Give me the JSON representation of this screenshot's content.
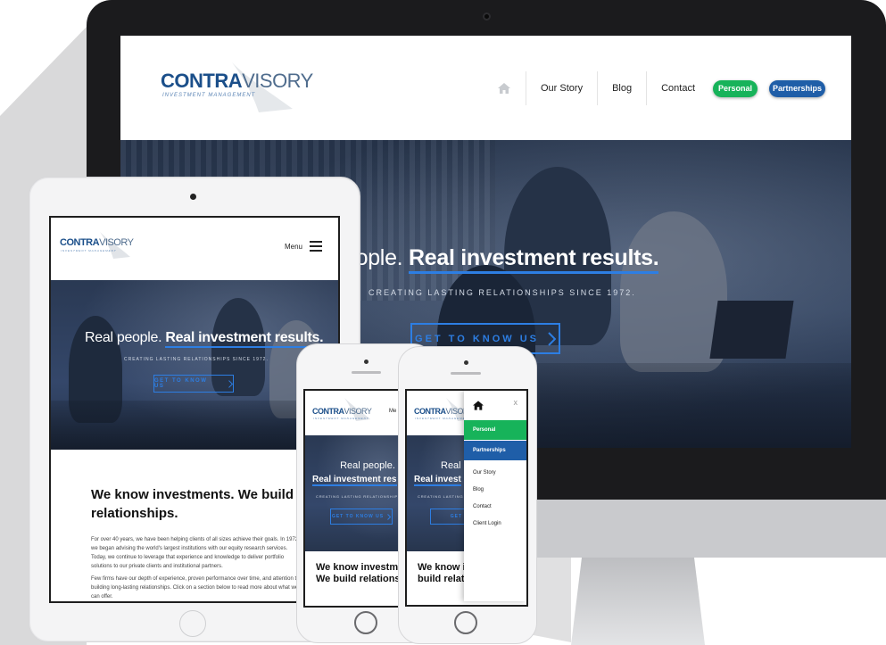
{
  "brand": {
    "name_bold": "CONTRA",
    "name_light": "VISORY",
    "tagline": "INVESTMENT MANAGEMENT"
  },
  "desktop": {
    "nav": {
      "home_icon": "home-icon",
      "items": [
        "Our Story",
        "Blog",
        "Contact"
      ],
      "personal_label": "Personal",
      "partnerships_label": "Partnerships"
    },
    "hero": {
      "title_light": "eople.",
      "title_bold": "Real investment results.",
      "subtitle": "CREATING LASTING RELATIONSHIPS SINCE 1972.",
      "cta_label": "GET TO KNOW US",
      "cta_icon": "chevron-right-icon"
    }
  },
  "tablet": {
    "menu_label": "Menu",
    "hero": {
      "title_light": "Real people.",
      "title_bold": "Real investment results.",
      "subtitle": "CREATING LASTING RELATIONSHIPS SINCE 1972.",
      "cta_label": "GET TO KNOW US"
    },
    "body": {
      "heading": "We know investments. We build relationships.",
      "para1": "For over 40 years, we have been helping clients of all sizes achieve their goals. In 1972 we began advising the world's largest institutions with our equity research services.  Today, we continue to leverage that experience and knowledge to deliver portfolio solutions to our private clients and institutional partners.",
      "para2": "Few firms have our depth of experience, proven performance over time, and attention to building long-lasting relationships. Click on a section below to read more about what we can offer."
    }
  },
  "phone1": {
    "menu_partial": "Me",
    "hero_line1": "Real people.",
    "hero_line2": "Real investment res",
    "subtitle": "CREATING LASTING RELATIONSHIPS SI",
    "cta_label": "GET TO KNOW US",
    "heading": "We know investments. We build relationships"
  },
  "phone2": {
    "hero_line1": "Real p",
    "hero_line2": "Real invest",
    "subtitle": "CREATING LASTING",
    "cta_label": "GET TO",
    "heading": "We know investment build relatio",
    "menu": {
      "close_label": "x",
      "personal_label": "Personal",
      "partnerships_label": "Partnerships",
      "items": [
        "Our Story",
        "Blog",
        "Contact",
        "Client Login"
      ]
    }
  },
  "colors": {
    "brand_blue": "#1b4f8a",
    "accent_blue": "#2d7ee3",
    "green": "#17b35a",
    "partnerships_blue": "#1f5ea8"
  }
}
